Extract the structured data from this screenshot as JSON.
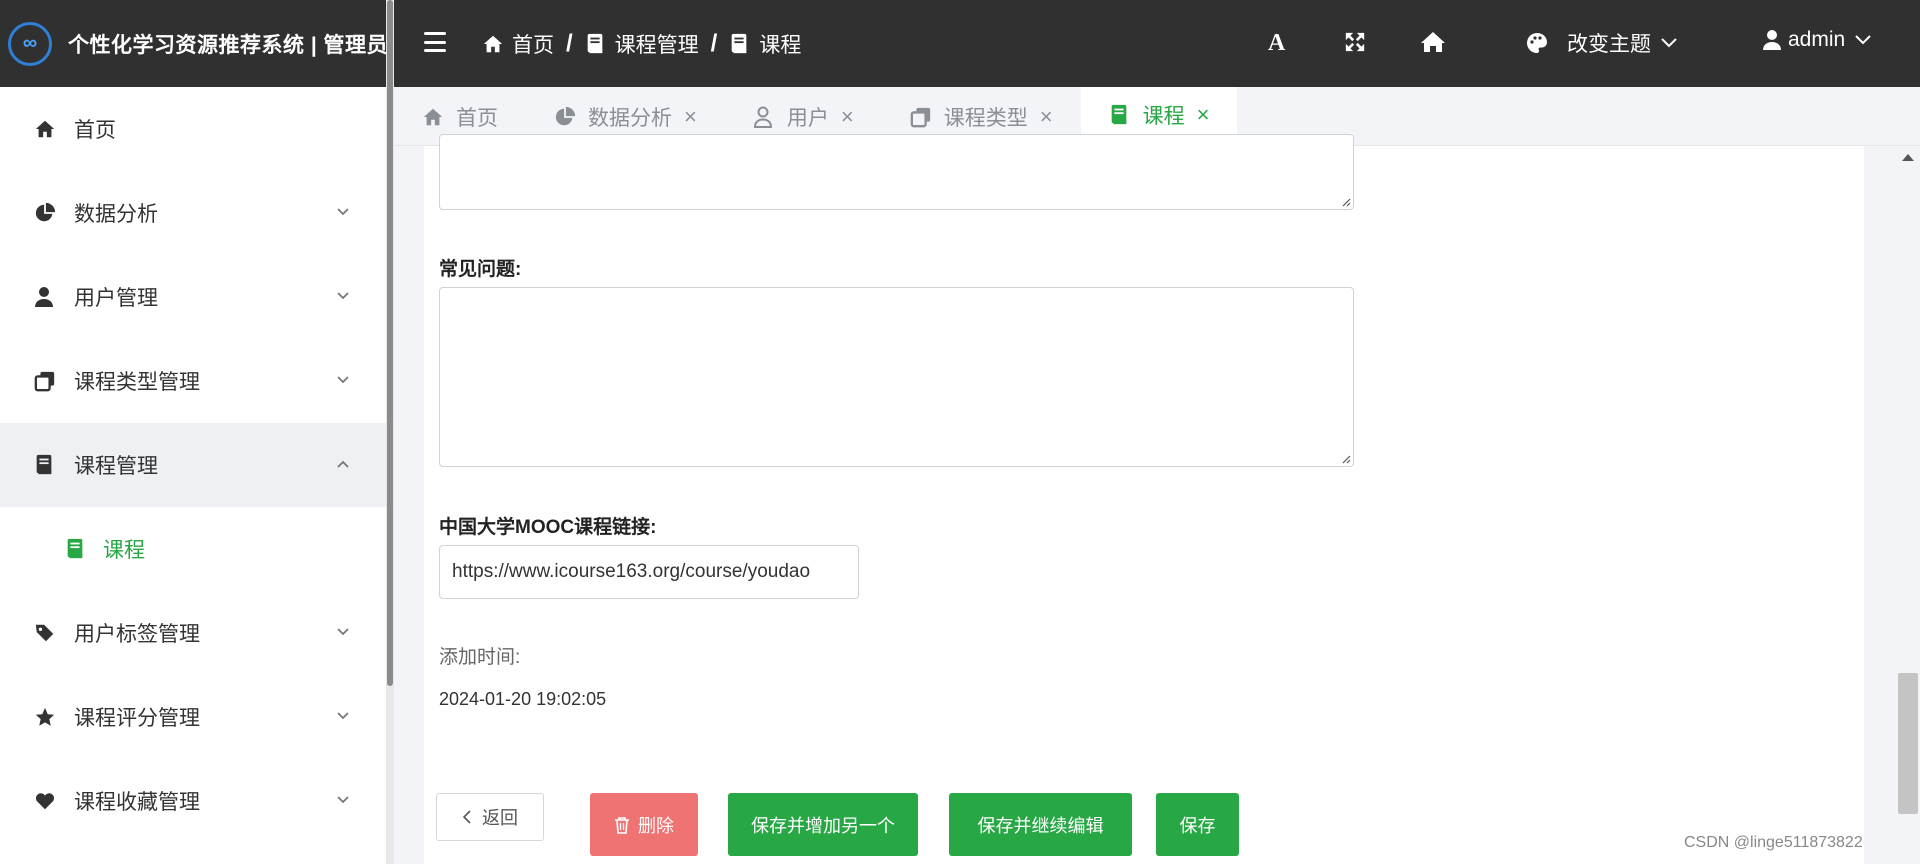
{
  "header": {
    "logo_text": "∞",
    "title": "个性化学习资源推荐系统 | 管理员",
    "breadcrumb": [
      "首页",
      "课程管理",
      "课程"
    ],
    "font_tool": "A",
    "theme_label": "改变主题",
    "user_label": "admin"
  },
  "sidebar": {
    "items": [
      {
        "label": "首页",
        "icon": "home-icon"
      },
      {
        "label": "数据分析",
        "icon": "pie-chart-icon"
      },
      {
        "label": "用户管理",
        "icon": "user-icon"
      },
      {
        "label": "课程类型管理",
        "icon": "copy-icon"
      },
      {
        "label": "课程管理",
        "icon": "book-icon",
        "open": true
      },
      {
        "label": "课程",
        "icon": "book-icon",
        "active": true
      },
      {
        "label": "用户标签管理",
        "icon": "tags-icon"
      },
      {
        "label": "课程评分管理",
        "icon": "star-icon"
      },
      {
        "label": "课程收藏管理",
        "icon": "heart-icon"
      }
    ]
  },
  "tabs": [
    {
      "label": "首页",
      "icon": "home-icon",
      "closable": false
    },
    {
      "label": "数据分析",
      "icon": "pie-chart-icon",
      "closable": true
    },
    {
      "label": "用户",
      "icon": "user-outline-icon",
      "closable": true
    },
    {
      "label": "课程类型",
      "icon": "copy-icon",
      "closable": true
    },
    {
      "label": "课程",
      "icon": "book-icon",
      "closable": true,
      "active": true
    }
  ],
  "form": {
    "faq_label": "常见问题:",
    "faq_value": "",
    "mooc_label": "中国大学MOOC课程链接:",
    "mooc_value": "https://www.icourse163.org/course/youdao",
    "added_time_label": "添加时间:",
    "added_time_value": "2024-01-20 19:02:05"
  },
  "buttons": {
    "back": "返回",
    "delete": "删除",
    "save_add_another": "保存并增加另一个",
    "save_continue": "保存并继续编辑",
    "save": "保存"
  },
  "colors": {
    "header_bg": "#303030",
    "accent_green": "#28a745",
    "danger": "#f07373",
    "logo_blue": "#2f7fd6"
  },
  "watermark": "CSDN @linge511873822"
}
